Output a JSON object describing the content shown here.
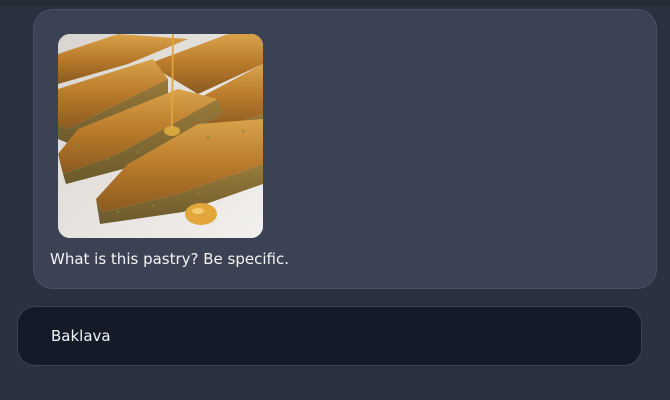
{
  "conversation": {
    "user_message": {
      "image_description_icon": "baklava-photo",
      "text": "What is this pastry? Be specific."
    },
    "assistant_message": {
      "text": "Baklava"
    }
  },
  "colors": {
    "background": "#2c3140",
    "user_bubble": "#3b4253",
    "assistant_bubble": "#141a27",
    "text": "#f3f4f6"
  }
}
